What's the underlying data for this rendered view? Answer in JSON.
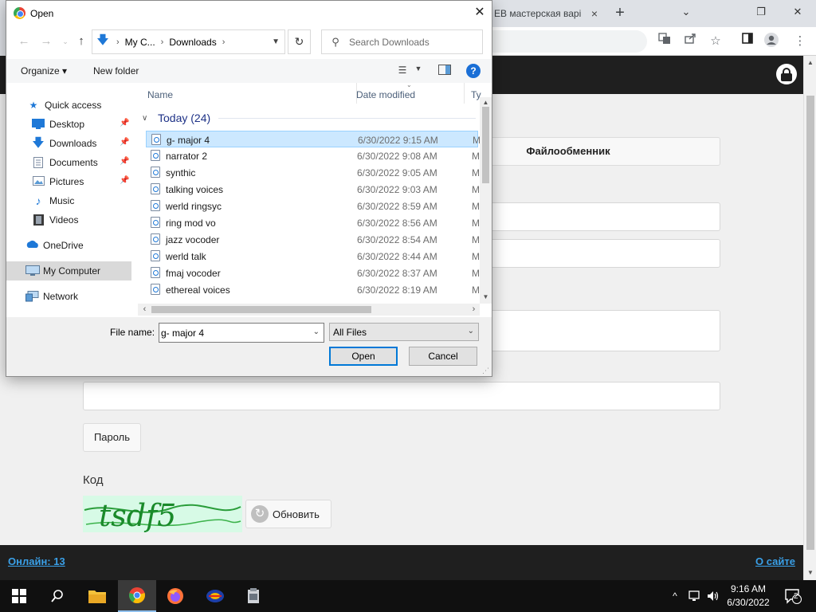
{
  "browser": {
    "tab_title": "EB мастерская варі",
    "tab_close": "×",
    "new_tab": "+",
    "window_controls": {
      "minimize": "⌄",
      "restore": "❐",
      "close": "✕"
    }
  },
  "page": {
    "file_share_button": "Файлообменник",
    "password_button": "Пароль",
    "code_label": "Код",
    "captcha_text": "tsdf5",
    "refresh_button": "Обновить",
    "footer_online": "Онлайн: 13",
    "footer_about": "О сайте"
  },
  "dialog": {
    "title": "Open",
    "close": "✕",
    "address": {
      "crumbs": [
        "My C...",
        "Downloads"
      ]
    },
    "search_placeholder": "Search Downloads",
    "toolbar": {
      "organize": "Organize",
      "organize_caret": "▾",
      "new_folder": "New folder",
      "help": "?"
    },
    "nav_pane": [
      {
        "label": "Quick access",
        "icon": "star-icon",
        "pinned": false
      },
      {
        "label": "Desktop",
        "icon": "desktop-icon",
        "pinned": true
      },
      {
        "label": "Downloads",
        "icon": "download-icon",
        "pinned": true
      },
      {
        "label": "Documents",
        "icon": "document-icon",
        "pinned": true
      },
      {
        "label": "Pictures",
        "icon": "pictures-icon",
        "pinned": true
      },
      {
        "label": "Music",
        "icon": "music-icon",
        "pinned": false
      },
      {
        "label": "Videos",
        "icon": "video-icon",
        "pinned": false
      },
      {
        "label": "OneDrive",
        "icon": "cloud-icon",
        "pinned": false
      },
      {
        "label": "My Computer",
        "icon": "computer-icon",
        "pinned": false,
        "selected": true
      },
      {
        "label": "Network",
        "icon": "network-icon",
        "pinned": false
      }
    ],
    "columns": {
      "name": "Name",
      "date": "Date modified",
      "type": "Ty"
    },
    "group": "Today (24)",
    "files": [
      {
        "name": "g- major 4",
        "date": "6/30/2022 9:15 AM",
        "type": "M",
        "selected": true
      },
      {
        "name": "narrator 2",
        "date": "6/30/2022 9:08 AM",
        "type": "M"
      },
      {
        "name": "synthic",
        "date": "6/30/2022 9:05 AM",
        "type": "M"
      },
      {
        "name": "talking  voices",
        "date": "6/30/2022 9:03 AM",
        "type": "M"
      },
      {
        "name": "werld ringsyc",
        "date": "6/30/2022 8:59 AM",
        "type": "M"
      },
      {
        "name": "ring mod vo",
        "date": "6/30/2022 8:56 AM",
        "type": "M"
      },
      {
        "name": "jazz vocoder",
        "date": "6/30/2022 8:54 AM",
        "type": "M"
      },
      {
        "name": "werld talk",
        "date": "6/30/2022 8:44 AM",
        "type": "M"
      },
      {
        "name": "fmaj vocoder",
        "date": "6/30/2022 8:37 AM",
        "type": "M"
      },
      {
        "name": "ethereal voices",
        "date": "6/30/2022 8:19 AM",
        "type": "M"
      }
    ],
    "file_name_label": "File name:",
    "file_name_value": "g- major 4",
    "file_type": "All Files",
    "open_button": "Open",
    "cancel_button": "Cancel"
  },
  "taskbar": {
    "time": "9:16 AM",
    "date": "6/30/2022",
    "notification_count": "2"
  },
  "colors": {
    "accent": "#0078d7",
    "selection": "#cce8ff",
    "footer_link": "#3aa0e8"
  }
}
